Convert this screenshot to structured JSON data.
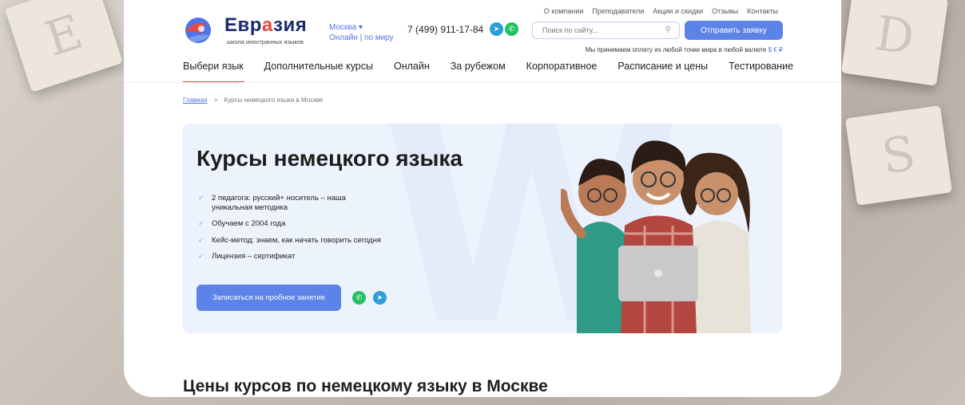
{
  "header": {
    "brand": "Евразия",
    "brand_prefix": "Евр",
    "brand_accent": "а",
    "brand_suffix": "зия",
    "slogan": "школа иностранных языков",
    "city": "Москва ▾",
    "online": "Онлайн | по миру",
    "phone": "7 (499) 911-17-84",
    "search_placeholder": "Поиск по сайту...",
    "send_button": "Отправить заявку",
    "payment_note": "Мы принимаем оплату из любой точки мира в любой валюте",
    "currencies": "$ € ₽"
  },
  "top_links": [
    "О компании",
    "Преподаватели",
    "Акции и скидки",
    "Отзывы",
    "Контакты"
  ],
  "nav": [
    "Выбери язык",
    "Дополнительные курсы",
    "Онлайн",
    "За рубежом",
    "Корпоративное",
    "Расписание и цены",
    "Тестирование"
  ],
  "breadcrumb": {
    "home": "Главная",
    "separator": ">",
    "current": "Курсы немецкого языка в Москве"
  },
  "hero": {
    "title": "Курсы немецкого языка",
    "features": [
      "2 педагога: русский+ носитель – наша уникальная методика",
      "Обучаем с 2004 года",
      "Кейс-метод: знаем, как начать говорить сегодня",
      "Лицензия – сертификат"
    ],
    "cta": "Записаться на пробное занятие"
  },
  "section_title": "Цены курсов по немецкому языку в Москве",
  "colors": {
    "accent": "#5c83e8",
    "brand_red": "#e84a3c",
    "brand_navy": "#1a2b6d",
    "telegram": "#2a9fd9",
    "whatsapp": "#25c061"
  },
  "icons": [
    "telegram-icon",
    "whatsapp-icon",
    "search-icon",
    "check-icon",
    "logo-icon"
  ]
}
